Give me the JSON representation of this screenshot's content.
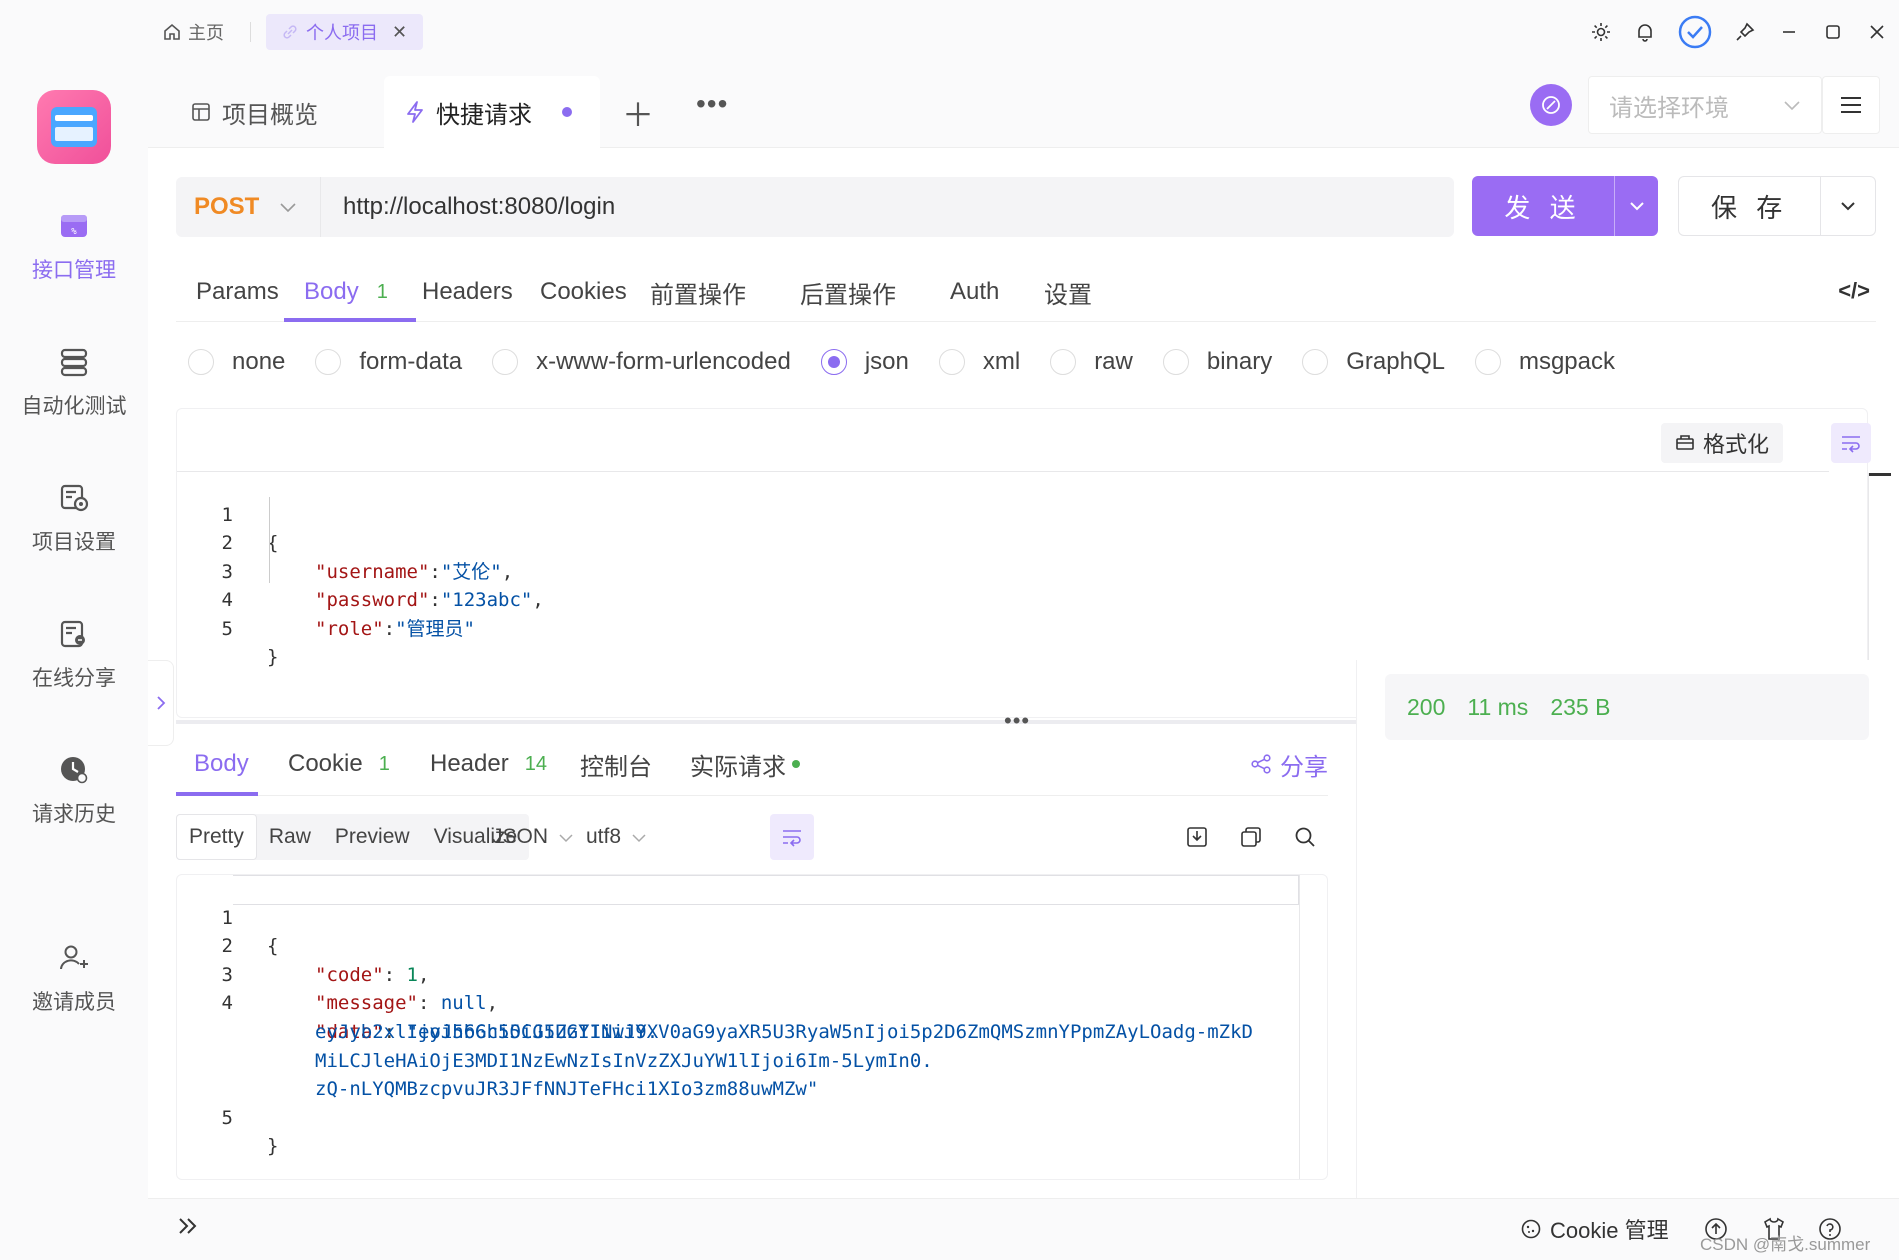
{
  "titlebar": {
    "home_label": "主页",
    "project_tab_label": "个人项目",
    "icons": [
      "gear-icon",
      "bell-icon",
      "check-circle-icon",
      "pin-icon",
      "minimize-icon",
      "maximize-icon",
      "close-icon"
    ]
  },
  "sidebar": {
    "items": [
      {
        "label": "接口管理",
        "icon": "api-icon",
        "active": true
      },
      {
        "label": "自动化测试",
        "icon": "automation-icon",
        "active": false
      },
      {
        "label": "项目设置",
        "icon": "settings-icon",
        "active": false
      },
      {
        "label": "在线分享",
        "icon": "share-doc-icon",
        "active": false
      },
      {
        "label": "请求历史",
        "icon": "history-icon",
        "active": false
      },
      {
        "label": "邀请成员",
        "icon": "add-user-icon",
        "active": false
      }
    ]
  },
  "tabs": {
    "overview_label": "项目概览",
    "quick_label": "快捷请求",
    "env_placeholder": "请选择环境"
  },
  "request": {
    "method": "POST",
    "url": "http://localhost:8080/login",
    "send_label": "发 送",
    "save_label": "保 存",
    "tabs": [
      {
        "label": "Params"
      },
      {
        "label": "Body",
        "count": "1"
      },
      {
        "label": "Headers"
      },
      {
        "label": "Cookies"
      },
      {
        "label": "前置操作"
      },
      {
        "label": "后置操作"
      },
      {
        "label": "Auth"
      },
      {
        "label": "设置"
      }
    ],
    "code_toggle": "</>",
    "body_types": [
      "none",
      "form-data",
      "x-www-form-urlencoded",
      "json",
      "xml",
      "raw",
      "binary",
      "GraphQL",
      "msgpack"
    ],
    "selected_body_type": "json",
    "format_label": "格式化",
    "body_lines": [
      {
        "n": "1",
        "text": "{"
      },
      {
        "n": "2",
        "key": "\"username\"",
        "sep": ":",
        "val": "\"艾伦\"",
        "end": ","
      },
      {
        "n": "3",
        "key": "\"password\"",
        "sep": ":",
        "val": "\"123abc\"",
        "end": ","
      },
      {
        "n": "4",
        "key": "\"role\"",
        "sep": ":",
        "val": "\"管理员\"",
        "end": ""
      },
      {
        "n": "5",
        "text": "}"
      }
    ]
  },
  "response": {
    "tabs": [
      {
        "label": "Body"
      },
      {
        "label": "Cookie",
        "count": "1"
      },
      {
        "label": "Header",
        "count": "14"
      },
      {
        "label": "控制台"
      },
      {
        "label": "实际请求"
      }
    ],
    "share_label": "分享",
    "modes": [
      "Pretty",
      "Raw",
      "Preview",
      "Visualize"
    ],
    "format": "JSON",
    "encoding": "utf8",
    "body": {
      "l1": "{",
      "code_key": "\"code\"",
      "code_val": "1",
      "message_key": "\"message\"",
      "message_val": "null",
      "data_key": "\"data\"",
      "data_val_1": "\"eyJhbGciOiJIUzI1NiJ9.",
      "data_val_2": "eyJyb2xlIjoi566h55CG5ZGYIiwiYXV0aG9yaXR5U3RyaW5nIjoi5p2D6ZmQMSzmnYPpmZAyLOadg-mZkD",
      "data_val_3": "MiLCJleHAiOjE3MDI1NzEwNzIsInVzZXJuYW1lIjoi6Im-5LymIn0.",
      "data_val_4": "zQ-nLYQMBzcpvuJR3JFfNNJTeFHci1XIo3zm88uwMZw\"",
      "l5": "}"
    },
    "status_code": "200",
    "time": "11 ms",
    "size": "235 B"
  },
  "footer": {
    "cookie_label": "Cookie 管理",
    "watermark": "CSDN @南戈.summer"
  },
  "colors": {
    "accent": "#8b6cf0",
    "method": "#f08a24",
    "success": "#4caf50"
  }
}
